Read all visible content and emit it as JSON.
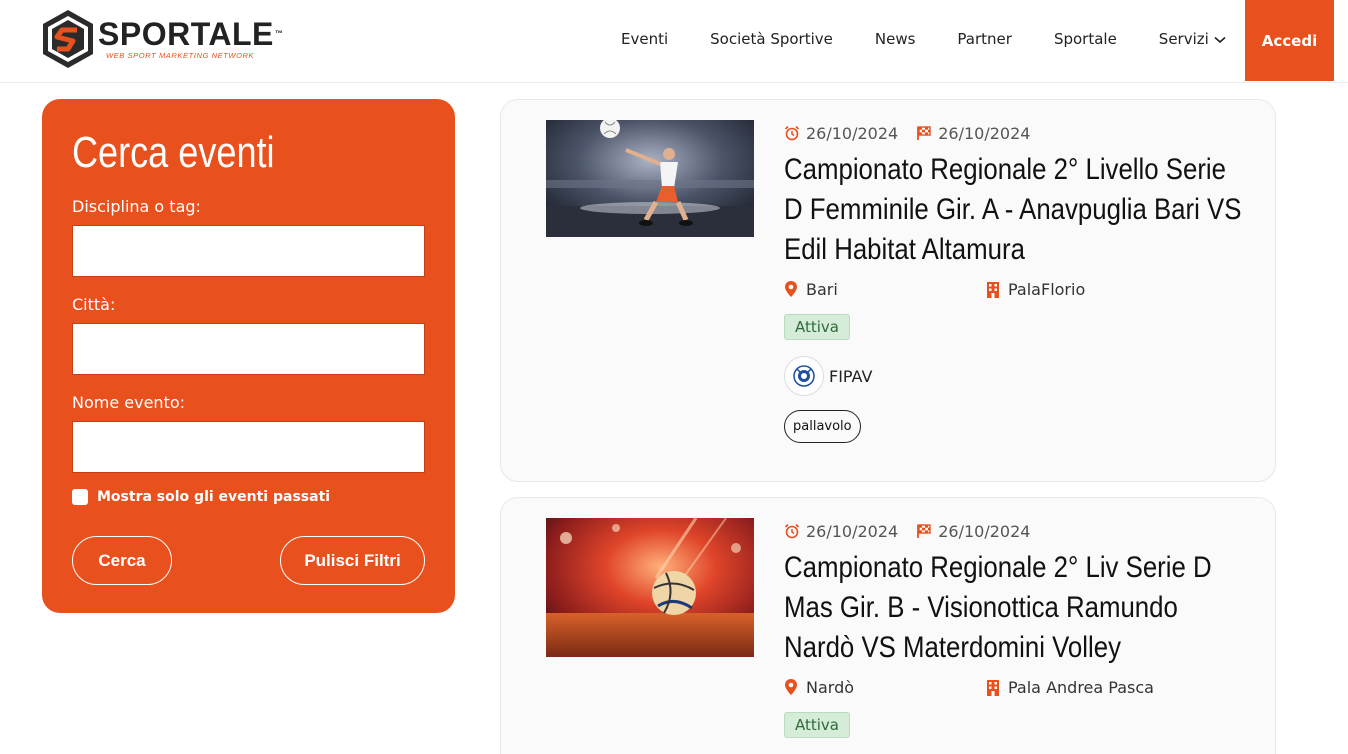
{
  "brand": {
    "name": "SPORTALE",
    "trademark": "™",
    "tagline": "WEB SPORT MARKETING NETWORK",
    "accent": "#e8501d"
  },
  "nav": {
    "items": [
      "Eventi",
      "Società Sportive",
      "News",
      "Partner",
      "Sportale"
    ],
    "servizi": "Servizi",
    "accedi": "Accedi"
  },
  "search": {
    "title": "Cerca eventi",
    "fields": [
      {
        "label": "Disciplina o tag:",
        "value": "",
        "placeholder": ""
      },
      {
        "label": "Città:",
        "value": "",
        "placeholder": ""
      },
      {
        "label": "Nome evento:",
        "value": "",
        "placeholder": ""
      }
    ],
    "past_only_label": "Mostra solo gli eventi passati",
    "cerca_label": "Cerca",
    "pulisci_label": "Pulisci Filtri"
  },
  "events": [
    {
      "start_date": "26/10/2024",
      "end_date": "26/10/2024",
      "title": "Campionato Regionale 2° Livello Serie D Femminile Gir. A - Anavpuglia Bari VS Edil Habitat Altamura",
      "city": "Bari",
      "venue": "PalaFlorio",
      "status": "Attiva",
      "federation": "FIPAV",
      "tag": "pallavolo"
    },
    {
      "start_date": "26/10/2024",
      "end_date": "26/10/2024",
      "title": "Campionato Regionale 2° Liv Serie D Mas Gir. B - Visionottica Ramundo Nardò VS Materdomini Volley",
      "city": "Nardò",
      "venue": "Pala Andrea Pasca",
      "status": "Attiva"
    }
  ]
}
